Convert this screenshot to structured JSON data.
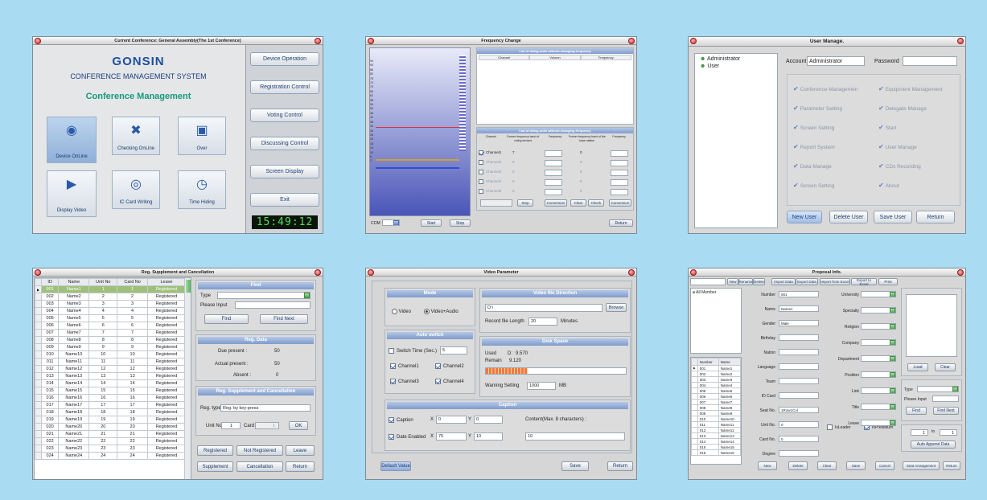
{
  "w1": {
    "title": "Current Conference:  General Assembly(The 1st Conference)",
    "brand": "GONSIN",
    "system": "CONFERENCE MANAGEMENT SYSTEM",
    "section": "Conference Management",
    "icons": [
      {
        "label": "Device OnLine",
        "icon": "device-online-icon"
      },
      {
        "label": "Checking OnLine",
        "icon": "checking-online-icon"
      },
      {
        "label": "Over",
        "icon": "over-icon"
      },
      {
        "label": "Display Video",
        "icon": "display-video-icon"
      },
      {
        "label": "IC Card Writing",
        "icon": "ic-card-writing-icon"
      },
      {
        "label": "Time Hiding",
        "icon": "time-hiding-icon"
      }
    ],
    "menu": [
      "Device Operation",
      "Registration Control",
      "Voting Control",
      "Discussing Control",
      "Screen Display",
      "Exit"
    ],
    "clock": "15:49:12"
  },
  "w2": {
    "title": "Frequency Change",
    "scale": [
      "94",
      "90",
      "86",
      "82",
      "78",
      "74",
      "70",
      "66",
      "62",
      "58",
      "54",
      "50",
      "46",
      "42",
      "38",
      "34",
      "30",
      "26",
      "22",
      "18",
      "14",
      "10",
      "6",
      "2"
    ],
    "top_header": "List of riding units without changing frequency",
    "top_cols": [
      "Channel",
      "Volumn",
      "Frequency"
    ],
    "bottom_header": "List of riding units without changing frequency",
    "bottom_cols": [
      "Channel",
      "Former frequency band of voting devices",
      "Frequency",
      "Former frequency band of the base station",
      "Frequency"
    ],
    "rows": [
      {
        "ch": "Channel1",
        "a": "7",
        "b": "0",
        "on": true
      },
      {
        "ch": "Channel2",
        "a": "8",
        "b": "8",
        "on": false
      },
      {
        "ch": "Channel3",
        "a": "8",
        "b": "8",
        "on": false
      },
      {
        "ch": "Channel4",
        "a": "8",
        "b": "8",
        "on": false
      },
      {
        "ch": "Channel5",
        "a": "8",
        "b": "8",
        "on": false
      }
    ],
    "buttons": [
      "Stop",
      "Conversion",
      "Clear",
      "Check",
      "Conversion"
    ],
    "com_label": "COM",
    "start": "Start",
    "stop": "Stop",
    "return": "Return"
  },
  "w3": {
    "title": "User Manage.",
    "tree": [
      "Administrator",
      "User"
    ],
    "account_label": "Account",
    "account": "Administrator",
    "password_label": "Password",
    "perms": [
      [
        "Conference Managemen",
        "Equipment Management"
      ],
      [
        "Parameter Setting",
        "Delegate Manage"
      ],
      [
        "Screen Setting",
        "Start"
      ],
      [
        "Report System",
        "User Manage"
      ],
      [
        "Data Manage",
        "CDs Recording"
      ],
      [
        "Screen Setting",
        "About"
      ]
    ],
    "buttons": [
      "New User",
      "Delete User",
      "Save User",
      "Return"
    ]
  },
  "w4": {
    "title": "Reg. Supplement and Cancellation",
    "cols": [
      "ID",
      "Name",
      "Unit No",
      "Card No",
      "Leave"
    ],
    "rows": [
      [
        "001",
        "Name1",
        "1",
        "1",
        "Registered"
      ],
      [
        "002",
        "Name2",
        "2",
        "2",
        "Registered"
      ],
      [
        "003",
        "Name3",
        "3",
        "3",
        "Registered"
      ],
      [
        "004",
        "Name4",
        "4",
        "4",
        "Registered"
      ],
      [
        "005",
        "Name5",
        "5",
        "5",
        "Registered"
      ],
      [
        "006",
        "Name6",
        "6",
        "6",
        "Registered"
      ],
      [
        "007",
        "Name7",
        "7",
        "7",
        "Registered"
      ],
      [
        "008",
        "Name8",
        "8",
        "8",
        "Registered"
      ],
      [
        "009",
        "Name9",
        "9",
        "9",
        "Registered"
      ],
      [
        "010",
        "Name10",
        "10",
        "10",
        "Registered"
      ],
      [
        "011",
        "Name11",
        "11",
        "11",
        "Registered"
      ],
      [
        "012",
        "Name12",
        "12",
        "12",
        "Registered"
      ],
      [
        "013",
        "Name13",
        "13",
        "13",
        "Registered"
      ],
      [
        "014",
        "Name14",
        "14",
        "14",
        "Registered"
      ],
      [
        "015",
        "Name15",
        "15",
        "15",
        "Registered"
      ],
      [
        "016",
        "Name16",
        "16",
        "16",
        "Registered"
      ],
      [
        "017",
        "Name17",
        "17",
        "17",
        "Registered"
      ],
      [
        "018",
        "Name18",
        "18",
        "18",
        "Registered"
      ],
      [
        "019",
        "Name19",
        "19",
        "19",
        "Registered"
      ],
      [
        "020",
        "Name20",
        "20",
        "20",
        "Registered"
      ],
      [
        "021",
        "Name21",
        "21",
        "21",
        "Registered"
      ],
      [
        "022",
        "Name22",
        "22",
        "22",
        "Registered"
      ],
      [
        "023",
        "Name23",
        "23",
        "23",
        "Registered"
      ],
      [
        "024",
        "Name24",
        "24",
        "24",
        "Registered"
      ]
    ],
    "find": "Find",
    "type": "Type",
    "please_input": "Please Input",
    "find_btn": "Find",
    "find_next": "Find Next",
    "reg_data": "Reg. Data",
    "due": "Due present :",
    "due_v": "50",
    "actual": "Actual present :",
    "actual_v": "50",
    "absent": "Absent :",
    "absent_v": "0",
    "supp": "Reg. Supplement and Cancellation",
    "reg_type": "Reg. type",
    "reg_type_v": "Reg. by key-press",
    "unit_no": "Unit No",
    "unit_v": "1",
    "card": "Card",
    "card_v": "1",
    "ok": "OK",
    "buttons": [
      "Registered",
      "Not Registered",
      "Leave",
      "Supplement",
      "Cancellation",
      "Return"
    ]
  },
  "w5": {
    "title": "Video Parameter",
    "mode": "Mode",
    "video": "Video",
    "video_audio": "Video+Audio",
    "auto": "Auto switch",
    "switch_time": "Switch Time (Sec.)",
    "switch_v": "5",
    "channels": [
      "Channel1",
      "Channel2",
      "Channel3",
      "Channel4"
    ],
    "dir": "Video file Direction",
    "dir_v": "D:\\",
    "browse": "Browse",
    "rec_len": "Record file Length",
    "rec_v": "20",
    "minutes": "Minutes",
    "disk": "Disk Space",
    "used": "Used",
    "used_d": "D:",
    "used_v": "9.570",
    "remain": "Remain",
    "remain_v": "9.120",
    "warn": "Warning Setting",
    "warn_v": "1000",
    "mb": "MB",
    "caption": "Caption",
    "cap_label": "Caption",
    "cap_x": "0",
    "cap_y": "0",
    "date_label": "Date Enabled",
    "date_x": "75",
    "date_y": "10",
    "content": "Content(Max. 8 characters) :",
    "content_v": "10",
    "default": "Default Value",
    "save": "Save",
    "return": "Return",
    "xl": "X",
    "yl": "Y"
  },
  "w6": {
    "title": "Proposal Info.",
    "top_buttons": [
      "New",
      "Rename",
      "Delete",
      "Import Data",
      "Export Data",
      "Import from Excel",
      "Export to Excel",
      "Print"
    ],
    "tree": "All Member",
    "list_cols": [
      "Number",
      "Name"
    ],
    "list": [
      [
        "001",
        "Name1"
      ],
      [
        "002",
        "Name2"
      ],
      [
        "003",
        "Name3"
      ],
      [
        "004",
        "Name4"
      ],
      [
        "005",
        "Name5"
      ],
      [
        "006",
        "Name6"
      ],
      [
        "007",
        "Name7"
      ],
      [
        "008",
        "Name8"
      ],
      [
        "009",
        "Name9"
      ],
      [
        "010",
        "Name10"
      ],
      [
        "011",
        "Name11"
      ],
      [
        "012",
        "Name12"
      ],
      [
        "013",
        "Name13"
      ],
      [
        "014",
        "Name14"
      ],
      [
        "015",
        "Name15"
      ],
      [
        "016",
        "Name16"
      ]
    ],
    "left_fields": [
      [
        "Number",
        "001"
      ],
      [
        "Name",
        "Name1"
      ],
      [
        "Gender",
        "Male"
      ],
      [
        "Birthday",
        ""
      ],
      [
        "Nation",
        ""
      ],
      [
        "Language",
        ""
      ],
      [
        "Team",
        ""
      ],
      [
        "ID Card",
        ""
      ],
      [
        "Seat No.",
        "1Row1Col"
      ],
      [
        "Unit No.",
        "0"
      ],
      [
        "Card No.",
        "0"
      ],
      [
        "Degree",
        ""
      ]
    ],
    "right_fields": [
      "University",
      "Specialty",
      "Religion",
      "Company",
      "Department",
      "Position",
      "Link",
      "Title",
      "Leave"
    ],
    "is_leader": "IsLeader",
    "is_president": "IsPresidium",
    "load": "Load",
    "clear": "Clear",
    "type": "Type",
    "please_input": "Please Input",
    "find": "Find",
    "find_next": "Find Next",
    "to": "to",
    "range_a": "1",
    "range_b": "1",
    "auto_append": "Auto Append Data",
    "bottom_buttons": [
      "New",
      "Delete",
      "Clear",
      "Save",
      "Cancel",
      "Seat Arrangement",
      "Return"
    ]
  }
}
